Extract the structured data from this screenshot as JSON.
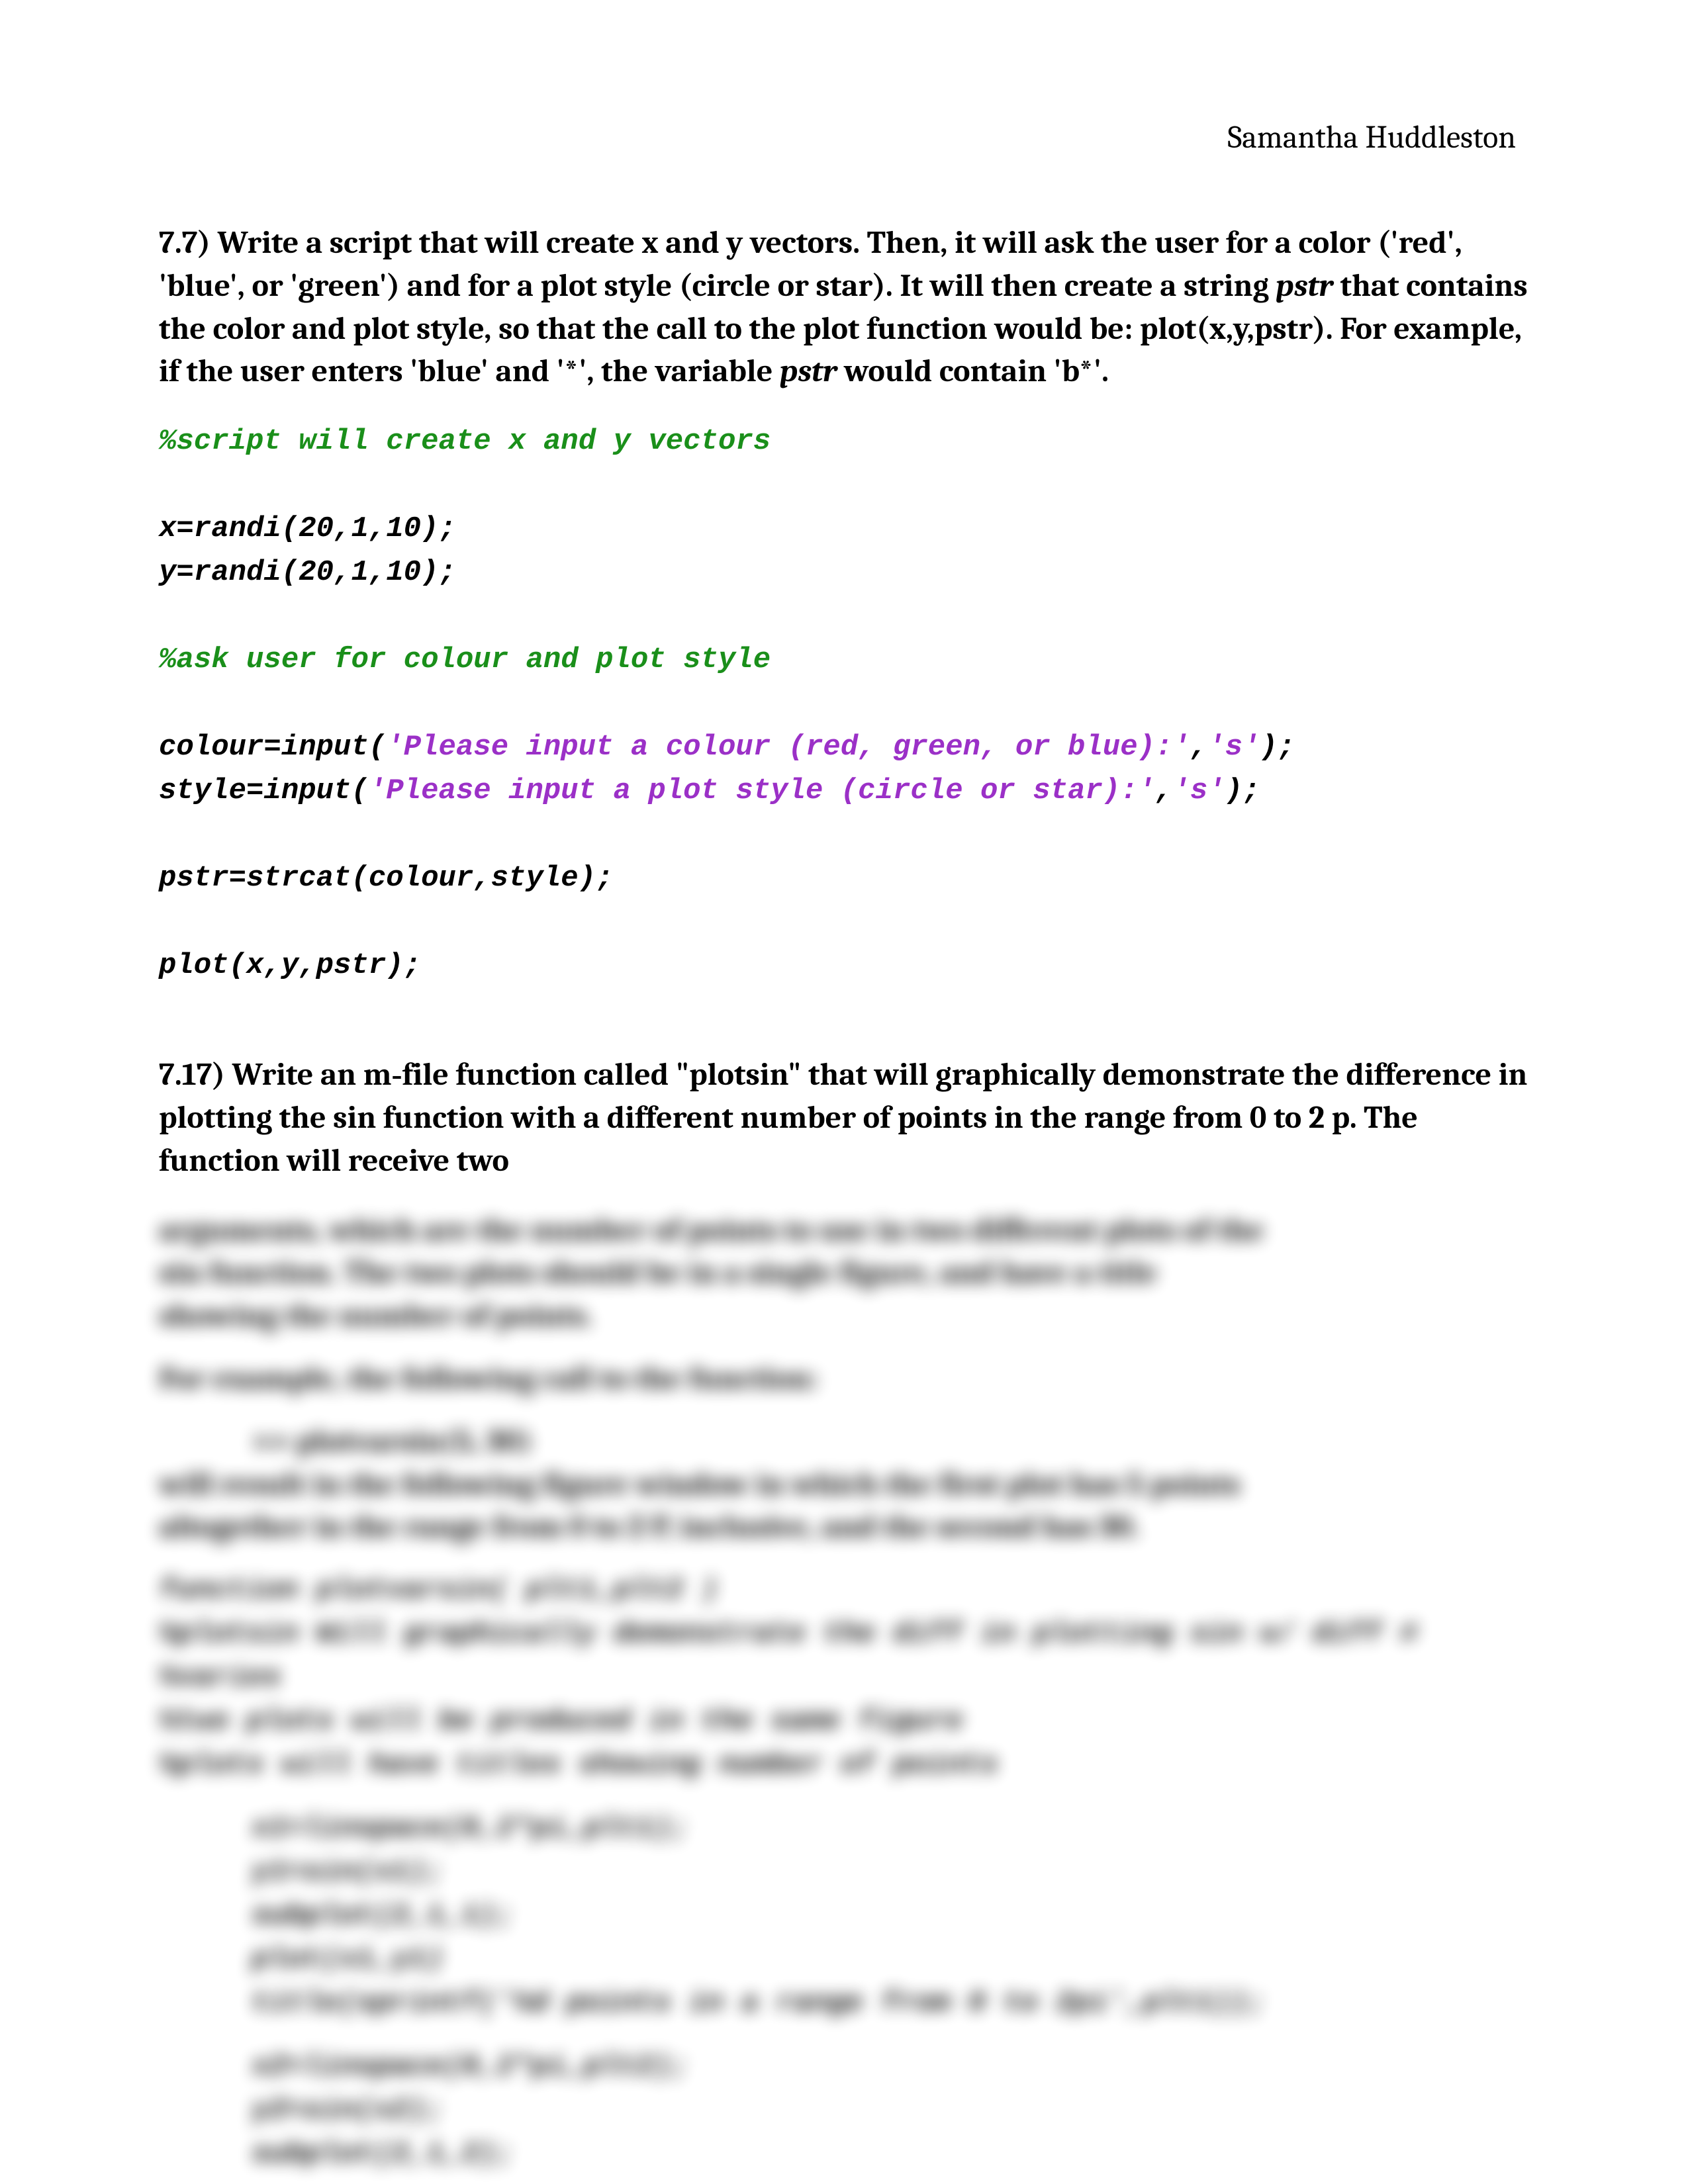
{
  "author": "Samantha Huddleston",
  "problem1": {
    "number": "7.7)",
    "text_part1": " Write a script that will create x and y vectors. Then, it will ask the user for a color ('red', 'blue', or 'green') and for a plot style (circle or star). It will then create a string ",
    "em1": "pstr",
    "text_part2": " that contains the color and plot style, so that the call to the plot function would be: plot(x,y,pstr). For example, if the user enters 'blue' and '*', the variable ",
    "em2": "pstr",
    "text_part3": " would contain 'b*'.",
    "code": {
      "comment1": "%script will create x and y vectors",
      "line_x": "x=randi(20,1,10);",
      "line_y": "y=randi(20,1,10);",
      "comment2": "%ask user for colour and plot style",
      "colour_pre": "colour=input(",
      "colour_str1": "'Please input a colour (red, green, or blue):'",
      "colour_mid": ",",
      "colour_str2": "'s'",
      "colour_post": ");",
      "style_pre": "style=input(",
      "style_str1": "'Please input a plot style (circle or star):'",
      "style_mid": ",",
      "style_str2": "'s'",
      "style_post": ");",
      "line_pstr": "pstr=strcat(colour,style);",
      "line_plot": "plot(x,y,pstr);"
    }
  },
  "problem2": {
    "number": "7.17)",
    "text_part1": " Write an m‑file function called \"plotsin\" that will graphically demonstrate the difference in plotting the sin function with a different number of points in the range from 0 to 2 p. The function will receive two "
  },
  "blurred": {
    "h1": "arguments, which are the number of points to use in two different plots of the",
    "h2": "sin function. The two plots should be in a single figure, and have a title",
    "h3": "showing the number of points.",
    "h4": "For example, the following call to the function:",
    "h5": ">> plotvarsin(5, 30)",
    "h6": "will result in the following figure window in which the first plot has 5 points",
    "h7": "altogether in the range from 0 to 2 P, inclusive, and the second has 30.",
    "c_kw": "function",
    "c1": " plotvarsin( plt1,plt2 )",
    "c2": "%plotsin Will graphically demonstrate the diff in plotting sin w/ diff #",
    "c3": "%varies",
    "c4": "%two plots will be produced in the same figure",
    "c5": "%plots will have titles showing number of points",
    "c6": "x1=linspace(0,2*pi,plt1);",
    "c7": "y1=sin(x1);",
    "c8": "subplot(2,1,1);",
    "c9": "plot(x1,y1)",
    "c10_pre": "title(sprintf(",
    "c10_str": "'%d points in a range from 0 to 2pi'",
    "c10_post": ",plt1));",
    "c11": "x2=linspace(0,2*pi,plt2);",
    "c12": "y2=sin(x2);",
    "c13": "subplot(2,1,2);"
  }
}
